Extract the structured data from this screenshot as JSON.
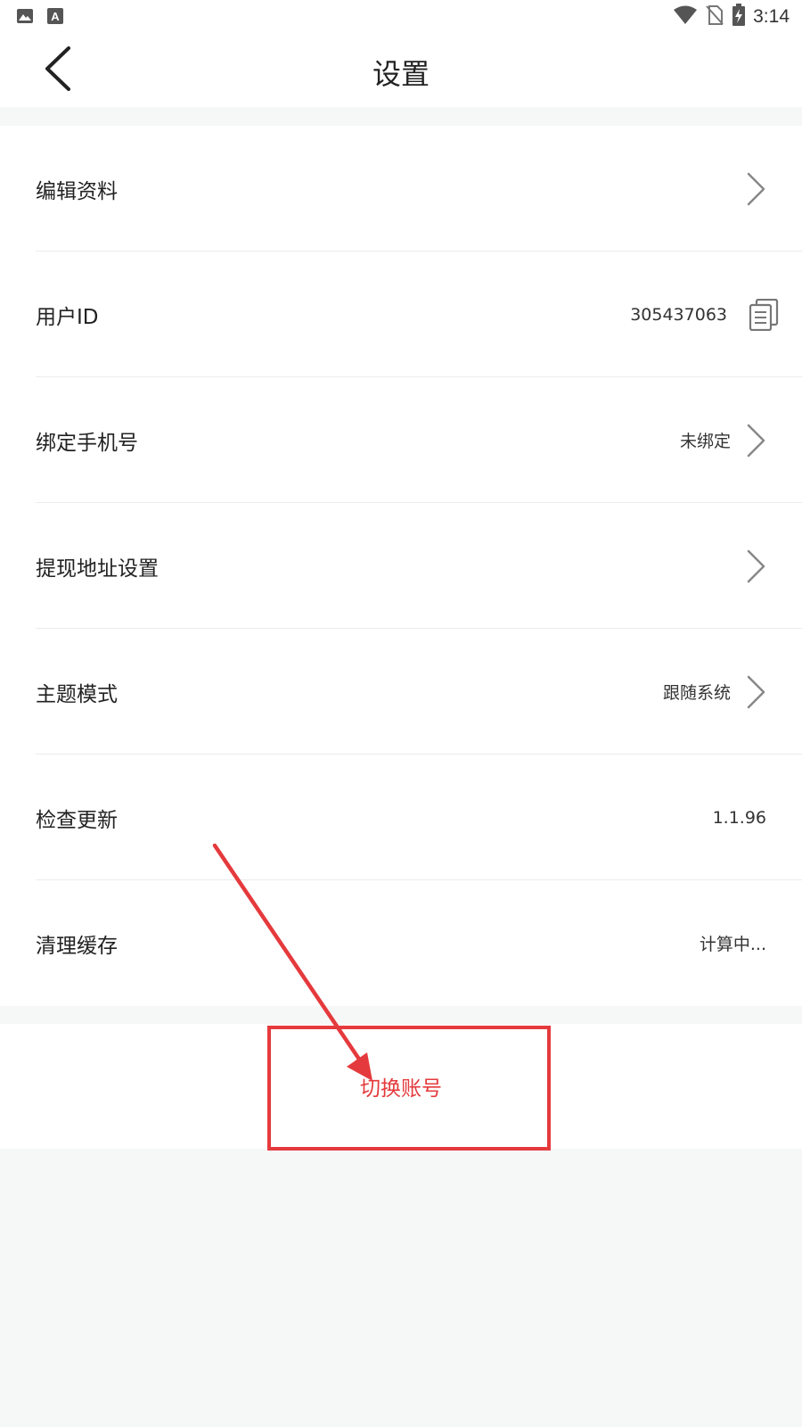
{
  "status_bar": {
    "time": "3:14",
    "left_icons": [
      "image-icon",
      "font-a-icon"
    ],
    "right_icons": [
      "wifi-icon",
      "no-sim-icon",
      "battery-charging-icon"
    ]
  },
  "nav": {
    "title": "设置",
    "back_icon": "chevron-left-icon"
  },
  "settings": {
    "items": [
      {
        "label": "编辑资料",
        "value": "",
        "trailing": "chevron-right-icon"
      },
      {
        "label": "用户ID",
        "value": "305437063",
        "trailing": "copy-icon"
      },
      {
        "label": "绑定手机号",
        "value": "未绑定",
        "trailing": "chevron-right-icon"
      },
      {
        "label": "提现地址设置",
        "value": "",
        "trailing": "chevron-right-icon"
      },
      {
        "label": "主题模式",
        "value": "跟随系统",
        "trailing": "chevron-right-icon"
      },
      {
        "label": "检查更新",
        "value": "1.1.96",
        "trailing": ""
      },
      {
        "label": "清理缓存",
        "value": "计算中...",
        "trailing": ""
      }
    ]
  },
  "switch_account": {
    "label": "切换账号"
  },
  "colors": {
    "accent_red": "#e53a3d",
    "background": "#f6f7f7",
    "divider": "#ececec"
  }
}
